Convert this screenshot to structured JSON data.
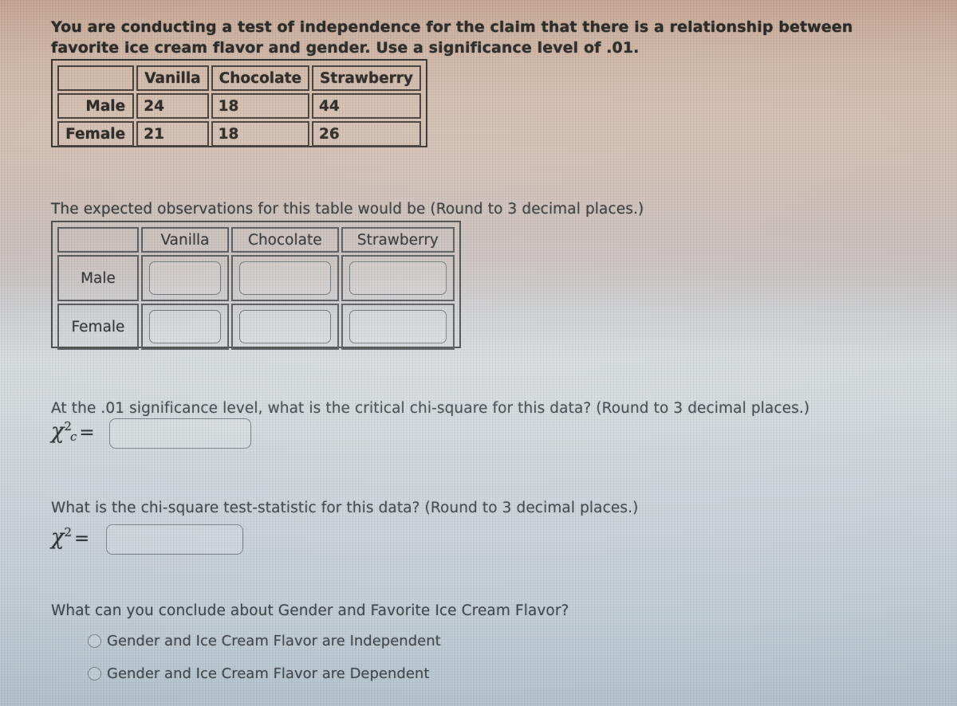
{
  "problem": {
    "intro": "You are conducting a test of independence for the claim that there is a relationship between favorite ice cream flavor and gender. Use a significance level of .01.",
    "expected_prompt": "The expected observations for this table would be (Round to 3 decimal places.)",
    "critical_prompt": "At the .01 significance level, what is the critical chi-square for this data? (Round to 3 decimal places.)",
    "teststat_prompt": "What is the chi-square test-statistic for this data? (Round to 3 decimal places.)",
    "conclusion_prompt": "What can you conclude about Gender and Favorite Ice Cream Flavor?"
  },
  "observed_table": {
    "corner_label": "",
    "columns": [
      "Vanilla",
      "Chocolate",
      "Strawberry"
    ],
    "rows": [
      {
        "label": "Male",
        "values": [
          "24",
          "18",
          "44"
        ]
      },
      {
        "label": "Female",
        "values": [
          "21",
          "18",
          "26"
        ]
      }
    ]
  },
  "expected_table": {
    "corner_label": "",
    "columns": [
      "Vanilla",
      "Chocolate",
      "Strawberry"
    ],
    "rows": [
      {
        "label": "Male",
        "values": [
          "",
          "",
          ""
        ]
      },
      {
        "label": "Female",
        "values": [
          "",
          "",
          ""
        ]
      }
    ]
  },
  "critical_answer": {
    "symbol_base": "χ",
    "symbol_sup": "2",
    "symbol_sub": "c",
    "equals": "=",
    "value": ""
  },
  "teststat_answer": {
    "symbol_base": "χ",
    "symbol_sup": "2",
    "symbol_sub": "",
    "equals": "=",
    "value": ""
  },
  "conclusion_options": [
    {
      "label": "Gender and Ice Cream Flavor are Independent",
      "selected": false
    },
    {
      "label": "Gender and Ice Cream Flavor are Dependent",
      "selected": false
    }
  ],
  "colors": {
    "background_top": "#c6a18c",
    "background_mid": "#d3dade",
    "background_bottom": "#b2c3cf",
    "text_dark": "#2b2b29",
    "text_cool": "#41484c",
    "table_border_warm": "#4a403b",
    "table_border_cool": "#55565a",
    "input_border": "#6f7478"
  }
}
